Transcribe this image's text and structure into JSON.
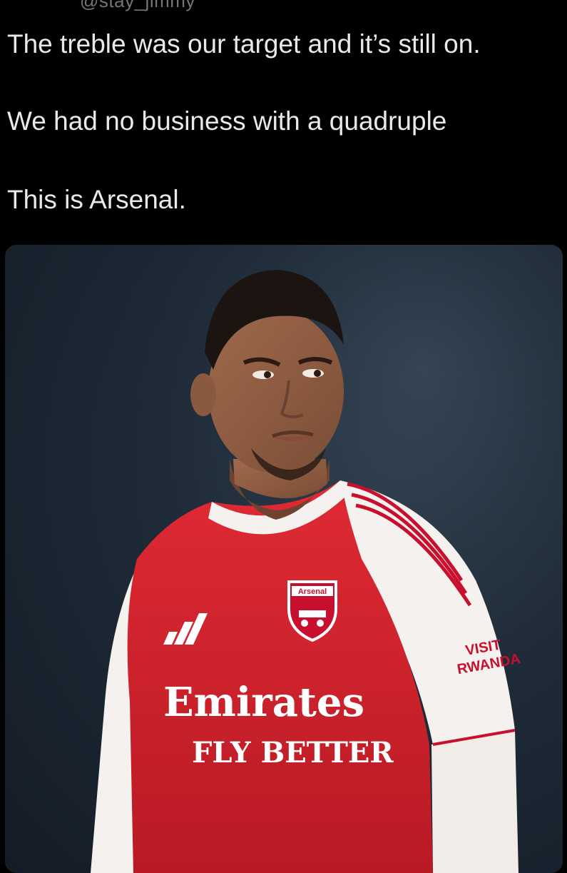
{
  "tweet": {
    "handle": "@stay_jimmy",
    "lines": [
      "The treble was our target and it’s still on.",
      "We had no business with a quadruple",
      "This is Arsenal."
    ]
  },
  "media": {
    "crest_text": "Arsenal",
    "sponsor_line1": "Emirates",
    "sponsor_line2": "FLY BETTER",
    "sleeve_line1": "VISIT",
    "sleeve_line2": "RWANDA"
  },
  "colors": {
    "background": "#000000",
    "text": "#e7e9ea",
    "muted": "#71767b",
    "kit_red": "#d41f2b",
    "kit_white": "#f4f1ee"
  }
}
